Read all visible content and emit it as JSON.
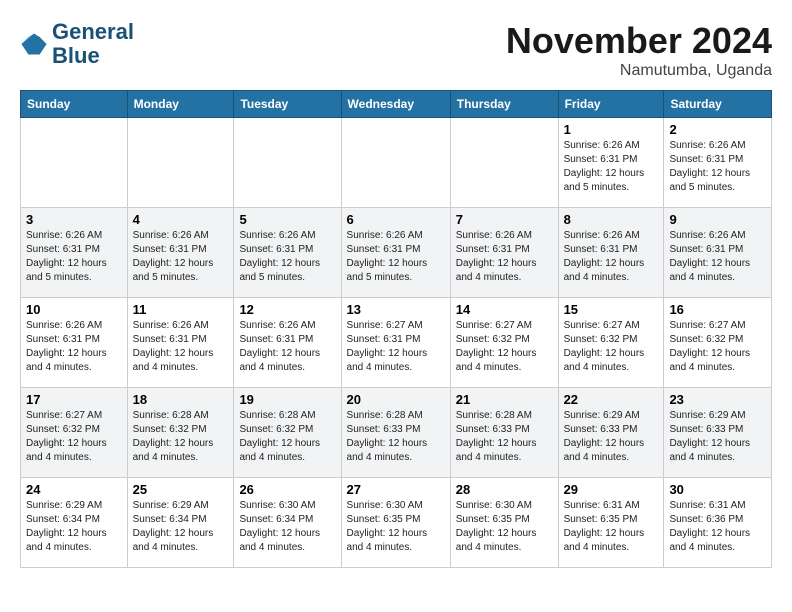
{
  "header": {
    "logo_line1": "General",
    "logo_line2": "Blue",
    "month_year": "November 2024",
    "location": "Namutumba, Uganda"
  },
  "weekdays": [
    "Sunday",
    "Monday",
    "Tuesday",
    "Wednesday",
    "Thursday",
    "Friday",
    "Saturday"
  ],
  "weeks": [
    [
      {
        "day": "",
        "info": ""
      },
      {
        "day": "",
        "info": ""
      },
      {
        "day": "",
        "info": ""
      },
      {
        "day": "",
        "info": ""
      },
      {
        "day": "",
        "info": ""
      },
      {
        "day": "1",
        "info": "Sunrise: 6:26 AM\nSunset: 6:31 PM\nDaylight: 12 hours and 5 minutes."
      },
      {
        "day": "2",
        "info": "Sunrise: 6:26 AM\nSunset: 6:31 PM\nDaylight: 12 hours and 5 minutes."
      }
    ],
    [
      {
        "day": "3",
        "info": "Sunrise: 6:26 AM\nSunset: 6:31 PM\nDaylight: 12 hours and 5 minutes."
      },
      {
        "day": "4",
        "info": "Sunrise: 6:26 AM\nSunset: 6:31 PM\nDaylight: 12 hours and 5 minutes."
      },
      {
        "day": "5",
        "info": "Sunrise: 6:26 AM\nSunset: 6:31 PM\nDaylight: 12 hours and 5 minutes."
      },
      {
        "day": "6",
        "info": "Sunrise: 6:26 AM\nSunset: 6:31 PM\nDaylight: 12 hours and 5 minutes."
      },
      {
        "day": "7",
        "info": "Sunrise: 6:26 AM\nSunset: 6:31 PM\nDaylight: 12 hours and 4 minutes."
      },
      {
        "day": "8",
        "info": "Sunrise: 6:26 AM\nSunset: 6:31 PM\nDaylight: 12 hours and 4 minutes."
      },
      {
        "day": "9",
        "info": "Sunrise: 6:26 AM\nSunset: 6:31 PM\nDaylight: 12 hours and 4 minutes."
      }
    ],
    [
      {
        "day": "10",
        "info": "Sunrise: 6:26 AM\nSunset: 6:31 PM\nDaylight: 12 hours and 4 minutes."
      },
      {
        "day": "11",
        "info": "Sunrise: 6:26 AM\nSunset: 6:31 PM\nDaylight: 12 hours and 4 minutes."
      },
      {
        "day": "12",
        "info": "Sunrise: 6:26 AM\nSunset: 6:31 PM\nDaylight: 12 hours and 4 minutes."
      },
      {
        "day": "13",
        "info": "Sunrise: 6:27 AM\nSunset: 6:31 PM\nDaylight: 12 hours and 4 minutes."
      },
      {
        "day": "14",
        "info": "Sunrise: 6:27 AM\nSunset: 6:32 PM\nDaylight: 12 hours and 4 minutes."
      },
      {
        "day": "15",
        "info": "Sunrise: 6:27 AM\nSunset: 6:32 PM\nDaylight: 12 hours and 4 minutes."
      },
      {
        "day": "16",
        "info": "Sunrise: 6:27 AM\nSunset: 6:32 PM\nDaylight: 12 hours and 4 minutes."
      }
    ],
    [
      {
        "day": "17",
        "info": "Sunrise: 6:27 AM\nSunset: 6:32 PM\nDaylight: 12 hours and 4 minutes."
      },
      {
        "day": "18",
        "info": "Sunrise: 6:28 AM\nSunset: 6:32 PM\nDaylight: 12 hours and 4 minutes."
      },
      {
        "day": "19",
        "info": "Sunrise: 6:28 AM\nSunset: 6:32 PM\nDaylight: 12 hours and 4 minutes."
      },
      {
        "day": "20",
        "info": "Sunrise: 6:28 AM\nSunset: 6:33 PM\nDaylight: 12 hours and 4 minutes."
      },
      {
        "day": "21",
        "info": "Sunrise: 6:28 AM\nSunset: 6:33 PM\nDaylight: 12 hours and 4 minutes."
      },
      {
        "day": "22",
        "info": "Sunrise: 6:29 AM\nSunset: 6:33 PM\nDaylight: 12 hours and 4 minutes."
      },
      {
        "day": "23",
        "info": "Sunrise: 6:29 AM\nSunset: 6:33 PM\nDaylight: 12 hours and 4 minutes."
      }
    ],
    [
      {
        "day": "24",
        "info": "Sunrise: 6:29 AM\nSunset: 6:34 PM\nDaylight: 12 hours and 4 minutes."
      },
      {
        "day": "25",
        "info": "Sunrise: 6:29 AM\nSunset: 6:34 PM\nDaylight: 12 hours and 4 minutes."
      },
      {
        "day": "26",
        "info": "Sunrise: 6:30 AM\nSunset: 6:34 PM\nDaylight: 12 hours and 4 minutes."
      },
      {
        "day": "27",
        "info": "Sunrise: 6:30 AM\nSunset: 6:35 PM\nDaylight: 12 hours and 4 minutes."
      },
      {
        "day": "28",
        "info": "Sunrise: 6:30 AM\nSunset: 6:35 PM\nDaylight: 12 hours and 4 minutes."
      },
      {
        "day": "29",
        "info": "Sunrise: 6:31 AM\nSunset: 6:35 PM\nDaylight: 12 hours and 4 minutes."
      },
      {
        "day": "30",
        "info": "Sunrise: 6:31 AM\nSunset: 6:36 PM\nDaylight: 12 hours and 4 minutes."
      }
    ]
  ]
}
